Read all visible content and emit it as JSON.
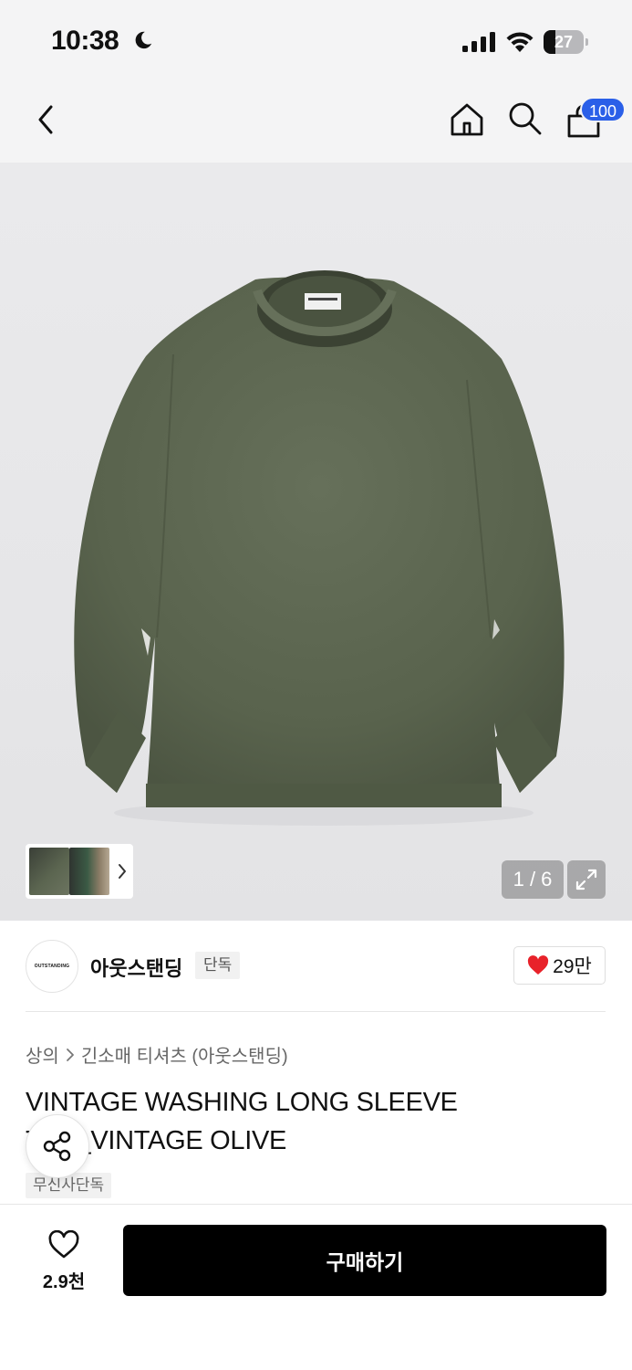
{
  "status_bar": {
    "time": "10:38",
    "battery_level": "27"
  },
  "nav": {
    "cart_badge": "100"
  },
  "gallery": {
    "page_indicator": "1 / 6",
    "current_page": 1,
    "total_pages": 6
  },
  "brand": {
    "logo_text": "OUTSTANDING",
    "name": "아웃스탠딩",
    "tag": "단독",
    "likes": "29만"
  },
  "breadcrumb": {
    "category": "상의",
    "subcategory": "긴소매 티셔츠 (아웃스탠딩)"
  },
  "product": {
    "title": "VINTAGE WASHING LONG SLEEVE TEE_VINTAGE OLIVE",
    "exclusive_tag": "무신사단독"
  },
  "bottom_bar": {
    "wish_count": "2.9천",
    "buy_label": "구매하기"
  },
  "colors": {
    "badge": "#2a5fe8",
    "heart": "#e8222a",
    "buy_button": "#000000",
    "shirt": "#5c6650"
  }
}
